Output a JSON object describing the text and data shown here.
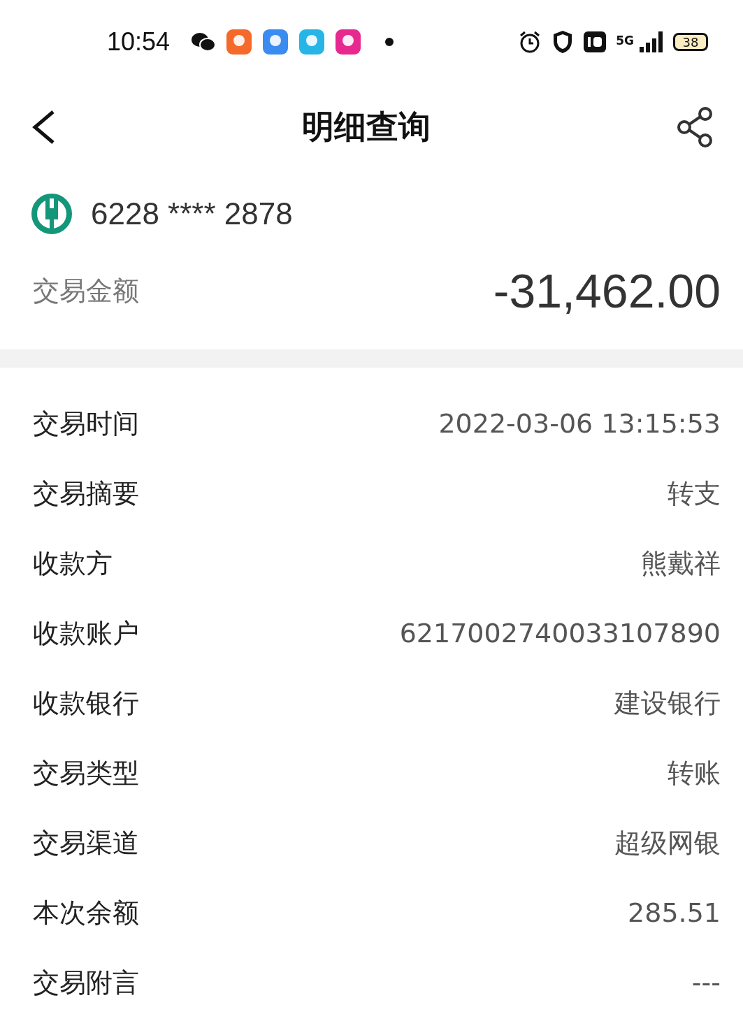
{
  "status_bar": {
    "time": "10:54",
    "network": "5G",
    "battery": "38"
  },
  "header": {
    "title": "明细查询"
  },
  "account": {
    "number": "6228 **** 2878"
  },
  "amount": {
    "label": "交易金额",
    "value": "-31,462.00"
  },
  "details": [
    {
      "label": "交易时间",
      "value": "2022-03-06 13:15:53"
    },
    {
      "label": "交易摘要",
      "value": "转支"
    },
    {
      "label": "收款方",
      "value": "熊戴祥"
    },
    {
      "label": "收款账户",
      "value": "6217002740033107890"
    },
    {
      "label": "收款银行",
      "value": "建设银行"
    },
    {
      "label": "交易类型",
      "value": "转账"
    },
    {
      "label": "交易渠道",
      "value": "超级网银"
    },
    {
      "label": "本次余额",
      "value": "285.51"
    },
    {
      "label": "交易附言",
      "value": "---"
    }
  ]
}
